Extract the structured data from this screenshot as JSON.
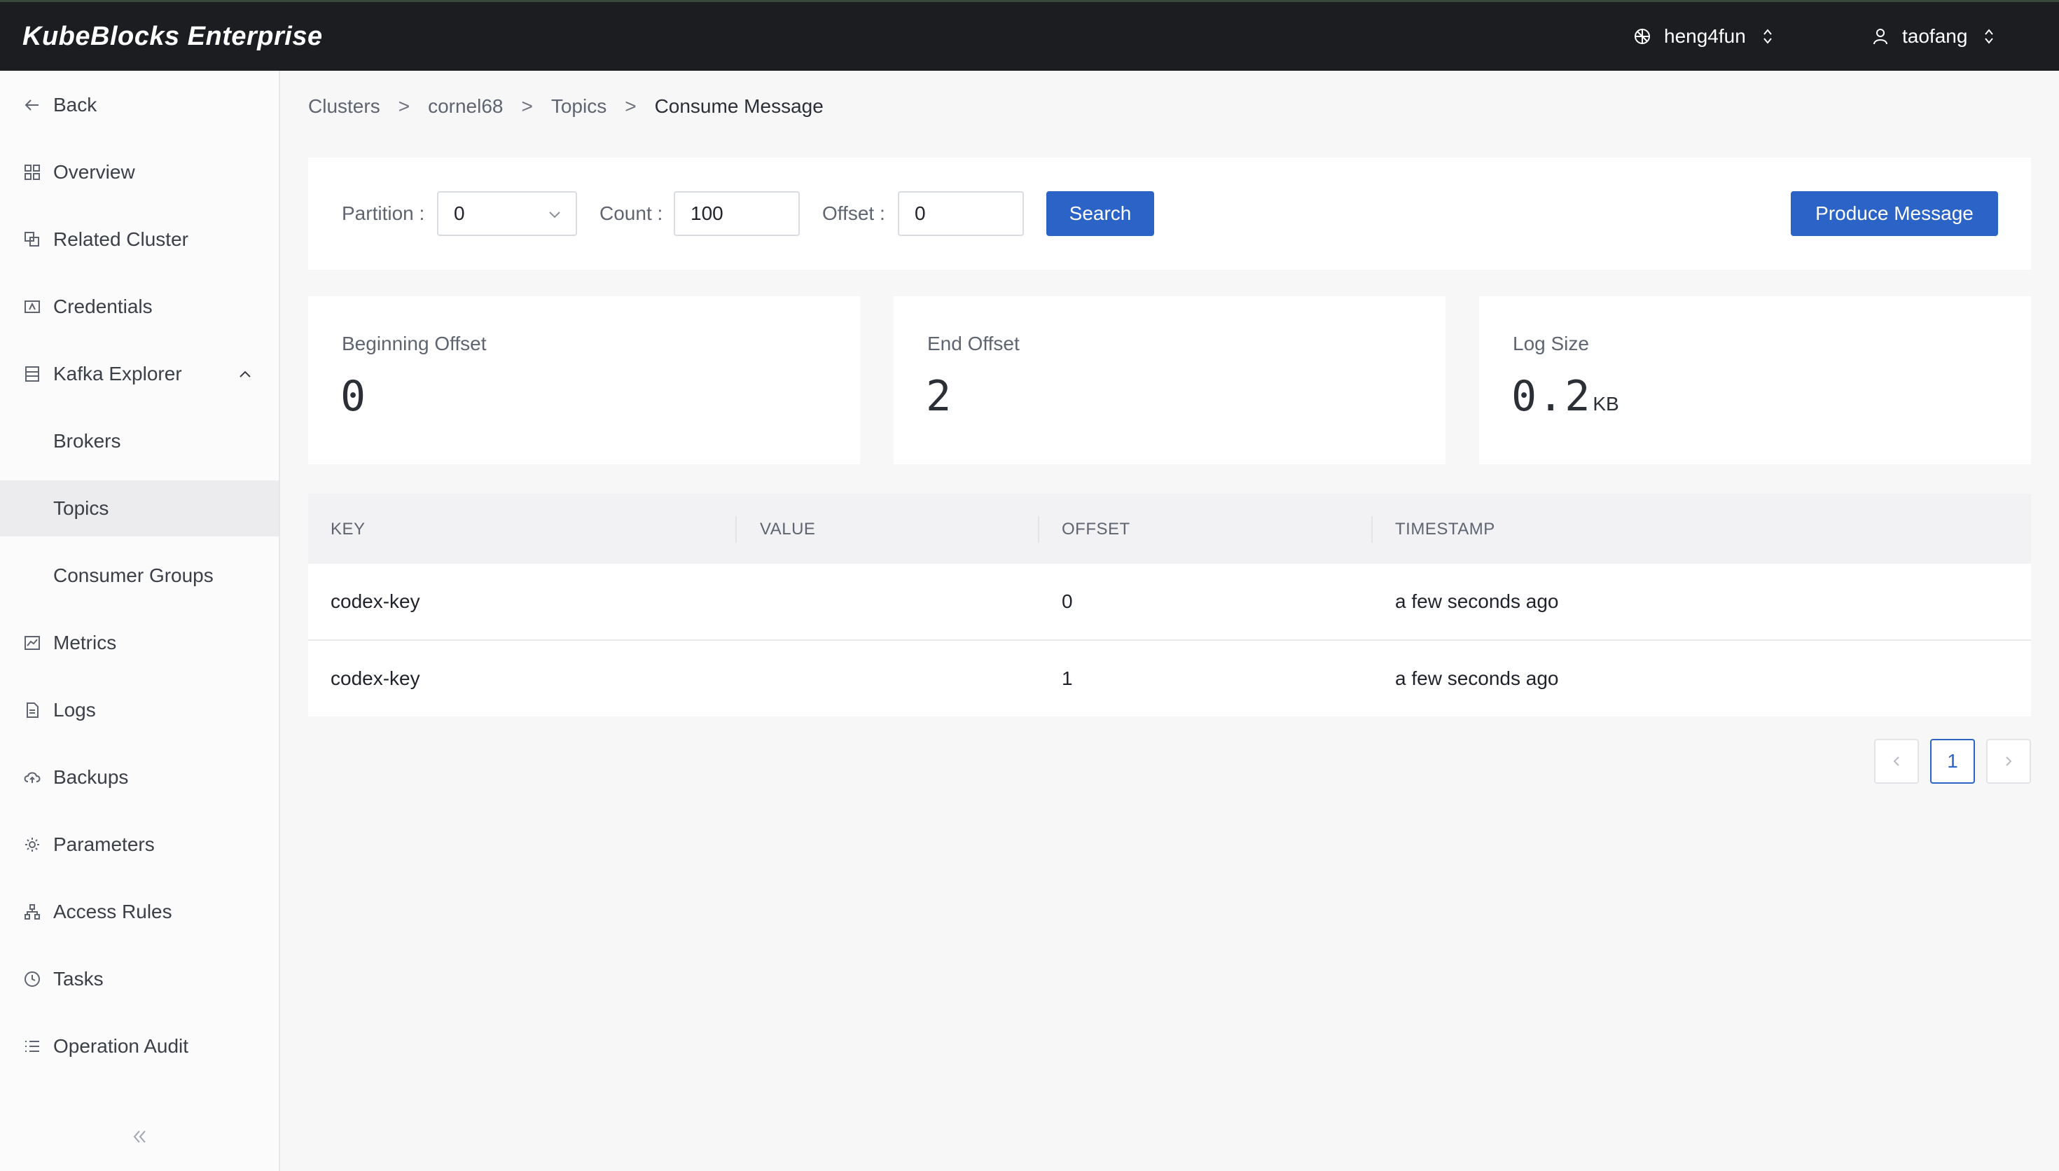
{
  "app": {
    "brand": "KubeBlocks Enterprise"
  },
  "header": {
    "org_name": "heng4fun",
    "user_name": "taofang"
  },
  "sidebar": {
    "back": "Back",
    "items": [
      {
        "label": "Overview",
        "icon": "grid-icon"
      },
      {
        "label": "Related Cluster",
        "icon": "copy-icon"
      },
      {
        "label": "Credentials",
        "icon": "id-card-icon"
      },
      {
        "label": "Kafka Explorer",
        "icon": "database-icon",
        "expanded": true
      },
      {
        "label": "Brokers"
      },
      {
        "label": "Topics",
        "active": true
      },
      {
        "label": "Consumer Groups"
      },
      {
        "label": "Metrics",
        "icon": "chart-icon"
      },
      {
        "label": "Logs",
        "icon": "file-icon"
      },
      {
        "label": "Backups",
        "icon": "cloud-upload-icon"
      },
      {
        "label": "Parameters",
        "icon": "gear-icon"
      },
      {
        "label": "Access Rules",
        "icon": "network-icon"
      },
      {
        "label": "Tasks",
        "icon": "clock-icon"
      },
      {
        "label": "Operation Audit",
        "icon": "list-icon"
      }
    ]
  },
  "breadcrumb": [
    "Clusters",
    "cornel68",
    "Topics",
    "Consume Message"
  ],
  "filters": {
    "partition_label": "Partition :",
    "partition_value": "0",
    "count_label": "Count :",
    "count_value": "100",
    "offset_label": "Offset :",
    "offset_value": "0",
    "search_button": "Search",
    "produce_button": "Produce Message"
  },
  "stats": {
    "beginning_offset": {
      "label": "Beginning Offset",
      "value": "0"
    },
    "end_offset": {
      "label": "End Offset",
      "value": "2"
    },
    "log_size": {
      "label": "Log Size",
      "value": "0.2",
      "unit": "KB"
    }
  },
  "table": {
    "columns": [
      "KEY",
      "VALUE",
      "OFFSET",
      "TIMESTAMP"
    ],
    "rows": [
      {
        "key": "codex-key",
        "value": "",
        "offset": "0",
        "timestamp": "a few seconds ago"
      },
      {
        "key": "codex-key",
        "value": "",
        "offset": "1",
        "timestamp": "a few seconds ago"
      }
    ]
  },
  "pagination": {
    "current_page": "1"
  },
  "colors": {
    "primary": "#2b63c6",
    "topbar": "#1b1d21",
    "sidebar_active": "#ececee"
  }
}
